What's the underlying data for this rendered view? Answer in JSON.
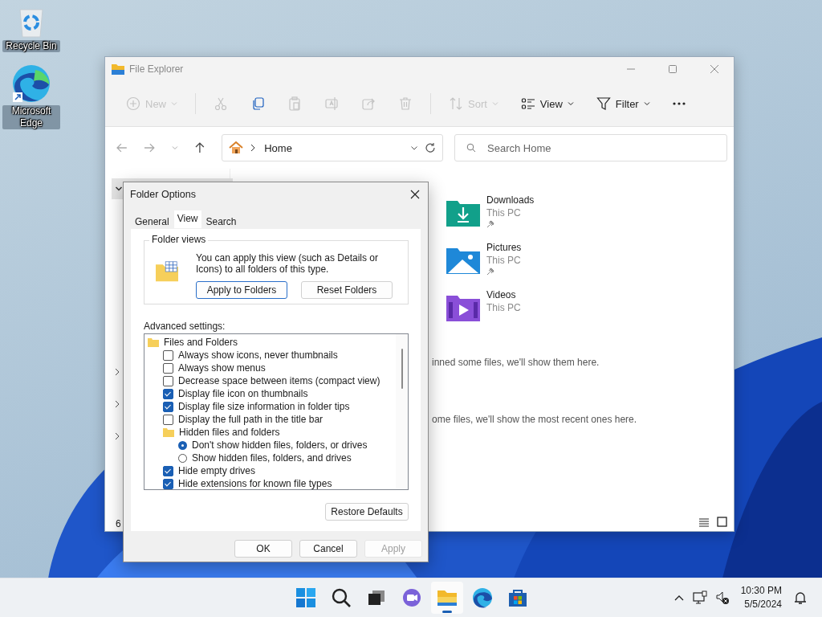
{
  "desktop_icons": [
    {
      "kind": "recycle",
      "label": "Recycle Bin"
    },
    {
      "kind": "edge",
      "label": "Microsoft Edge"
    }
  ],
  "explorer": {
    "title": "File Explorer",
    "toolbar": [
      {
        "kind": "new",
        "label": "New",
        "disabled": true
      },
      {
        "kind": "cut",
        "disabled": true
      },
      {
        "kind": "copy",
        "disabled": false
      },
      {
        "kind": "paste",
        "disabled": true
      },
      {
        "kind": "rename",
        "disabled": true
      },
      {
        "kind": "share",
        "disabled": true
      },
      {
        "kind": "delete",
        "disabled": true
      },
      {
        "kind": "sort",
        "label": "Sort",
        "disabled": true
      },
      {
        "kind": "view",
        "label": "View",
        "disabled": false
      },
      {
        "kind": "filter",
        "label": "Filter",
        "disabled": false
      },
      {
        "kind": "more",
        "disabled": false
      }
    ],
    "address": "Home",
    "search": {
      "placeholder": "Search Home"
    },
    "folders": [
      {
        "kind": "downloads",
        "name": "Downloads",
        "location": "This PC",
        "pinned": true
      },
      {
        "kind": "pictures",
        "name": "Pictures",
        "location": "This PC",
        "pinned": true
      },
      {
        "kind": "videos",
        "name": "Videos",
        "location": "This PC",
        "pinned": false
      }
    ],
    "messages": [
      "inned some files, we'll show them here.",
      "ome files, we'll show the most recent ones here."
    ],
    "status_text": "6"
  },
  "dialog": {
    "title": "Folder Options",
    "tabs": [
      {
        "label": "General",
        "selected": false
      },
      {
        "label": "View",
        "selected": true
      },
      {
        "label": "Search",
        "selected": false
      }
    ],
    "group_title": "Folder views",
    "description": "You can apply this view (such as Details or Icons) to all folders of this type.",
    "group_buttons": [
      "Apply to Folders",
      "Reset Folders"
    ],
    "advanced_label": "Advanced settings:",
    "advanced": [
      {
        "kind": "folder",
        "label": "Files and Folders",
        "children": [
          {
            "kind": "checkbox",
            "label": "Always show icons, never thumbnails",
            "checked": false
          },
          {
            "kind": "checkbox",
            "label": "Always show menus",
            "checked": false
          },
          {
            "kind": "checkbox",
            "label": "Decrease space between items (compact view)",
            "checked": false
          },
          {
            "kind": "checkbox",
            "label": "Display file icon on thumbnails",
            "checked": true
          },
          {
            "kind": "checkbox",
            "label": "Display file size information in folder tips",
            "checked": true
          },
          {
            "kind": "checkbox",
            "label": "Display the full path in the title bar",
            "checked": false
          },
          {
            "kind": "folder",
            "label": "Hidden files and folders",
            "children": [
              {
                "kind": "radio",
                "label": "Don't show hidden files, folders, or drives",
                "selected": true
              },
              {
                "kind": "radio",
                "label": "Show hidden files, folders, and drives",
                "selected": false
              }
            ]
          },
          {
            "kind": "checkbox",
            "label": "Hide empty drives",
            "checked": true
          },
          {
            "kind": "checkbox",
            "label": "Hide extensions for known file types",
            "checked": true
          }
        ]
      }
    ],
    "restore_button": "Restore Defaults",
    "footer_buttons": [
      {
        "label": "OK",
        "disabled": false
      },
      {
        "label": "Cancel",
        "disabled": false
      },
      {
        "label": "Apply",
        "disabled": true
      }
    ]
  },
  "taskbar": {
    "items": [
      {
        "kind": "start",
        "active": false
      },
      {
        "kind": "search",
        "active": false
      },
      {
        "kind": "taskview",
        "active": false
      },
      {
        "kind": "chat",
        "active": false
      },
      {
        "kind": "explorer",
        "active": true
      },
      {
        "kind": "edge",
        "active": false
      },
      {
        "kind": "store",
        "active": false
      }
    ],
    "time": "10:30 PM",
    "date": "5/5/2024"
  }
}
